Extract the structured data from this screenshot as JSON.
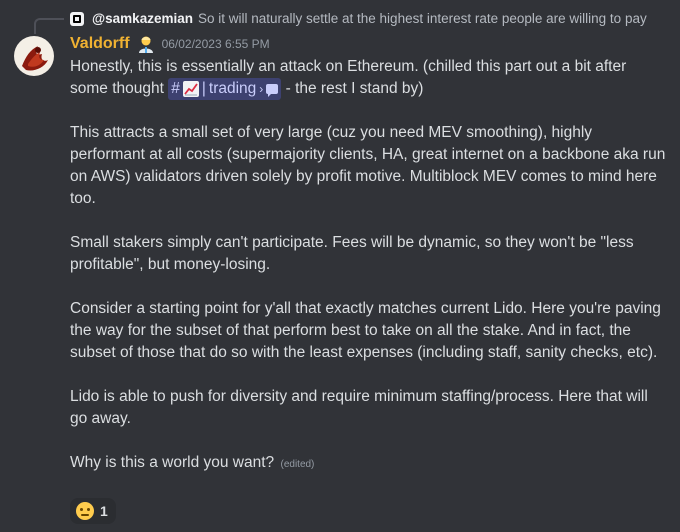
{
  "reply": {
    "username": "@samkazemian",
    "text": "So it will naturally settle at the highest interest rate people are willing to pay"
  },
  "message": {
    "username": "Valdorff",
    "timestamp": "06/02/2023 6:55 PM",
    "line1_before": "Honestly, this is essentially an attack on Ethereum. (chilled this part out a bit after some thought ",
    "channel_hash": "#",
    "channel_name": "trading",
    "line1_after": " - the rest I stand by)",
    "paragraph2": "This attracts a small set of very large (cuz you need MEV smoothing), highly performant at all costs (supermajority clients, HA, great internet on a backbone aka run on AWS) validators driven solely by profit motive. Multiblock MEV comes to mind here too.",
    "paragraph3": "Small stakers simply can't participate. Fees will be dynamic, so they won't be \"less profitable\", but money-losing.",
    "paragraph4": "Consider a starting point for y'all that exactly matches current Lido. Here you're paving the way for the subset of that perform best to take on all the stake. And in fact, the subset of those that do so with the least expenses (including staff, sanity checks, etc).",
    "paragraph5": "Lido is able to push for diversity and require minimum staffing/process. Here that will go away.",
    "paragraph6": "Why is this a world you want?",
    "edited": "(edited)"
  },
  "reaction": {
    "emoji": "neutral-face",
    "count": "1"
  },
  "colors": {
    "background": "#313338",
    "username": "#f0b232",
    "text": "#dbdee1",
    "muted": "#949ba4",
    "mention_bg": "#3c4270"
  }
}
